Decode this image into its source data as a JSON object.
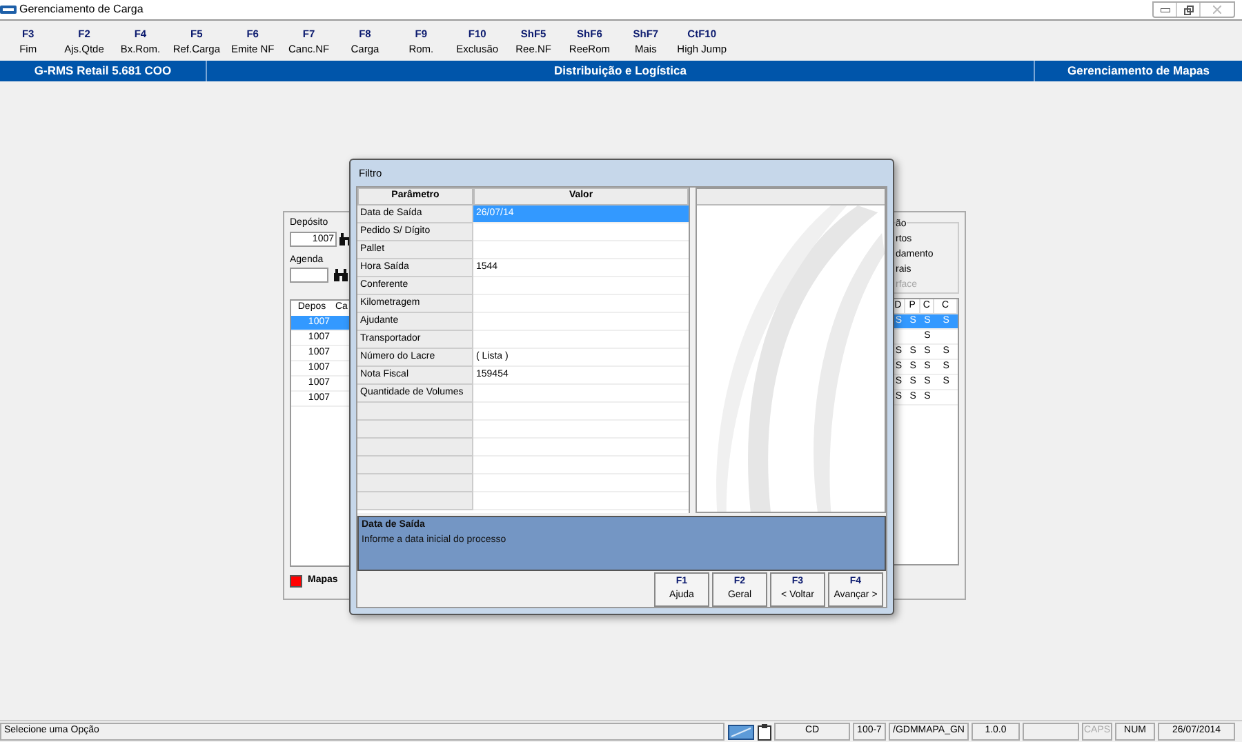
{
  "window": {
    "title": "Gerenciamento de Carga"
  },
  "toolbar": [
    {
      "key": "F3",
      "label": "Fim"
    },
    {
      "key": "F2",
      "label": "Ajs.Qtde"
    },
    {
      "key": "F4",
      "label": "Bx.Rom."
    },
    {
      "key": "F5",
      "label": "Ref.Carga"
    },
    {
      "key": "F6",
      "label": "Emite NF"
    },
    {
      "key": "F7",
      "label": "Canc.NF"
    },
    {
      "key": "F8",
      "label": "Carga"
    },
    {
      "key": "F9",
      "label": "Rom."
    },
    {
      "key": "F10",
      "label": "Exclusão"
    },
    {
      "key": "ShF5",
      "label": "Ree.NF"
    },
    {
      "key": "ShF6",
      "label": "ReeRom"
    },
    {
      "key": "ShF7",
      "label": "Mais"
    },
    {
      "key": "CtF10",
      "label": "High Jump"
    }
  ],
  "header_bar": [
    "G-RMS Retail 5.681 COO",
    "Distribuição e Logística",
    "Gerenciamento de Mapas"
  ],
  "background_panel": {
    "deposit_label": "Depósito",
    "deposit_value": "1007",
    "agenda_label": "Agenda",
    "group_title": "ão",
    "options": [
      {
        "label": "rtos",
        "disabled": false
      },
      {
        "label": "damento",
        "disabled": false
      },
      {
        "label": "rais",
        "disabled": false
      },
      {
        "label": "rface",
        "disabled": true
      }
    ],
    "left_table": {
      "columns": [
        "Depos",
        "Ca"
      ],
      "rows": [
        {
          "cell": "1007",
          "selected": true
        },
        {
          "cell": "1007",
          "selected": false
        },
        {
          "cell": "1007",
          "selected": false
        },
        {
          "cell": "1007",
          "selected": false
        },
        {
          "cell": "1007",
          "selected": false
        },
        {
          "cell": "1007",
          "selected": false
        }
      ]
    },
    "right_table": {
      "columns": [
        "D",
        "P",
        "C",
        "C"
      ],
      "rows": [
        {
          "cells": [
            "S",
            "S",
            "S",
            "S"
          ],
          "selected": true
        },
        {
          "cells": [
            null,
            null,
            "S",
            null
          ],
          "selected": false
        },
        {
          "cells": [
            "S",
            "S",
            "S",
            "S"
          ],
          "selected": false
        },
        {
          "cells": [
            "S",
            "S",
            "S",
            "S"
          ],
          "selected": false
        },
        {
          "cells": [
            "S",
            "S",
            "S",
            "S"
          ],
          "selected": false
        },
        {
          "cells": [
            "S",
            "S",
            "S",
            null
          ],
          "selected": false
        }
      ]
    },
    "legend": {
      "label": "Mapas"
    }
  },
  "dialog": {
    "title": "Filtro",
    "columns": [
      "Parâmetro",
      "Valor"
    ],
    "rows": [
      {
        "param": "Data de Saída",
        "value": "26/07/14",
        "selected": true
      },
      {
        "param": "Pedido S/ Dígito",
        "selected": false
      },
      {
        "param": "Pallet",
        "selected": false
      },
      {
        "param": "Hora Saída",
        "value": "1544",
        "selected": false
      },
      {
        "param": "Conferente",
        "selected": false
      },
      {
        "param": "Kilometragem",
        "selected": false
      },
      {
        "param": "Ajudante",
        "selected": false
      },
      {
        "param": "Transportador",
        "selected": false
      },
      {
        "param": "Número do Lacre",
        "value": "( Lista )",
        "selected": false
      },
      {
        "param": "Nota Fiscal",
        "value": "159454",
        "selected": false
      },
      {
        "param": "Quantidade de Volumes",
        "selected": false
      }
    ],
    "description": {
      "title": "Data de Saída",
      "text": "Informe a data inicial do processo"
    },
    "buttons": [
      {
        "key": "F1",
        "label": "Ajuda"
      },
      {
        "key": "F2",
        "label": "Geral"
      },
      {
        "key": "F3",
        "label": "< Voltar"
      },
      {
        "key": "F4",
        "label": "Avançar >"
      }
    ]
  },
  "status_bar": {
    "message": "Selecione uma Opção",
    "cells": [
      {
        "text": "CD",
        "disabled": false
      },
      {
        "text": "100-7",
        "disabled": false
      },
      {
        "text": "/GDMMAPA_GN",
        "disabled": false
      },
      {
        "text": "1.0.0",
        "disabled": false
      },
      {
        "text": "CAPS",
        "disabled": true
      },
      {
        "text": "NUM",
        "disabled": false
      },
      {
        "text": "26/07/2014",
        "disabled": false
      }
    ]
  }
}
